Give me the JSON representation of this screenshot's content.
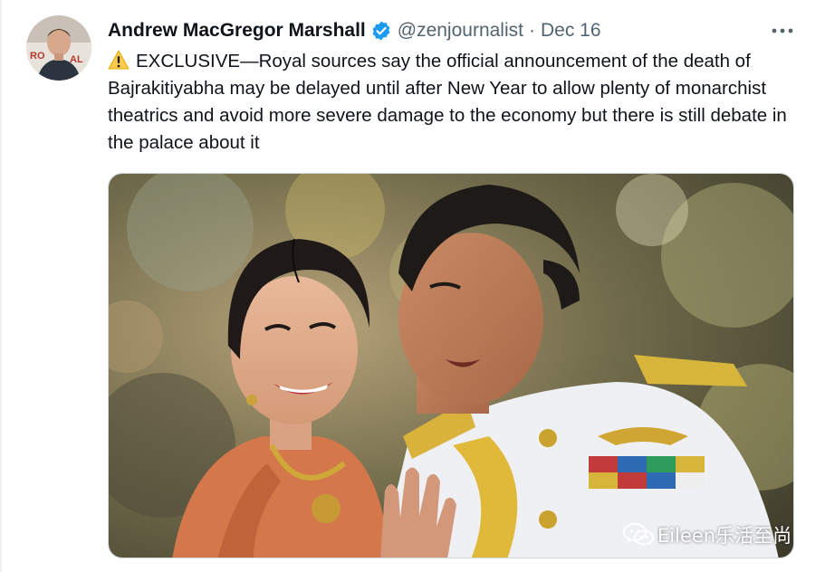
{
  "tweet": {
    "author_name": "Andrew MacGregor Marshall",
    "handle": "@zenjournalist",
    "separator": "·",
    "date": "Dec 16",
    "more_label": "•••",
    "text": "EXCLUSIVE—Royal sources say the official announcement of the death of Bajrakitiyabha may be delayed until after New Year to allow plenty of monarchist theatrics and avoid more severe damage to the economy but there is still debate in the palace about it",
    "media_alt": "Photo of a woman in an orange dress and a man in a white ceremonial uniform"
  },
  "watermark": {
    "text": "Eileen乐活至尚"
  },
  "icons": {
    "verified": "verified-badge-icon",
    "warning": "warning-icon",
    "more": "more-options-icon",
    "wechat": "wechat-icon"
  },
  "colors": {
    "verified_blue": "#1d9bf0",
    "text_primary": "#0f1419",
    "text_secondary": "#536471",
    "warning_yellow": "#ffcc4d"
  }
}
